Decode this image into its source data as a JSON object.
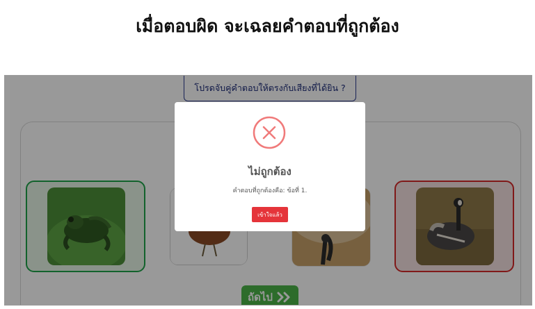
{
  "heading": "เมื่อตอบผิด จะเฉลยคำตอบที่ถูกต้อง",
  "question": "โปรดจับคู่คำตอบให้ตรงกับเสียงที่ได้ยิน ?",
  "choices": [
    {
      "animal": "frog",
      "state": "correct"
    },
    {
      "animal": "chicken",
      "state": "normal"
    },
    {
      "animal": "bird",
      "state": "normal"
    },
    {
      "animal": "goose",
      "state": "wrong"
    }
  ],
  "next_button": {
    "label": "ถัดไป",
    "icon": "double-chevron-right-icon"
  },
  "modal": {
    "icon": "x-circle-icon",
    "title": "ไม่ถูกต้อง",
    "message": "คำตอบที่ถูกต้องคือ: ข้อที่ 1.",
    "ok_label": "เข้าใจแล้ว"
  },
  "colors": {
    "correct": "#1fa34a",
    "wrong": "#d62b2b",
    "next": "#4cb548",
    "ok": "#e5343a",
    "question_border": "#2a3b8f"
  }
}
